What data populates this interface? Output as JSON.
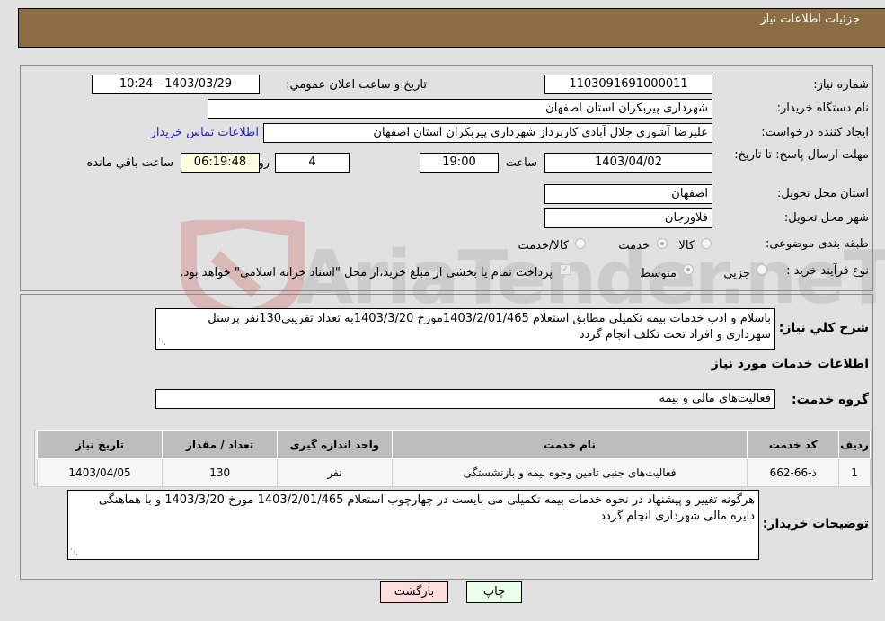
{
  "header": {
    "title": "جزئیات اطلاعات نیاز"
  },
  "fields": {
    "need_number": {
      "label": "شماره نیاز:",
      "value": "1103091691000011"
    },
    "announce_datetime": {
      "label": "تاریخ و ساعت اعلان عمومي:",
      "value": "1403/03/29 - 10:24"
    },
    "buyer_org": {
      "label": "نام دستگاه خریدار:",
      "value": "شهرداری پیربکران استان اصفهان"
    },
    "requester": {
      "label": "ایجاد کننده درخواست:",
      "value": "علیرضا آشوری جلال آبادی کاربرداز شهرداری پیربکران استان اصفهان"
    },
    "buyer_contact_link": "اطلاعات تماس خریدار",
    "deadline": {
      "label": "مهلت ارسال پاسخ: تا تاریخ:",
      "date": "1403/04/02",
      "time_label": "ساعت",
      "time": "19:00",
      "days": "4",
      "days_label": "روز و",
      "remaining": "06:19:48",
      "remaining_label": "ساعت باقي مانده"
    },
    "delivery_province": {
      "label": "استان محل تحویل:",
      "value": "اصفهان"
    },
    "delivery_city": {
      "label": "شهر محل تحویل:",
      "value": "فلاورجان"
    },
    "category": {
      "label": "طبقه بندی موضوعی:",
      "options": [
        "کالا",
        "خدمت",
        "کالا/خدمت"
      ],
      "selected": "خدمت"
    },
    "purchase_process": {
      "label": "نوع فرآیند خرید :",
      "options": [
        "جزیي",
        "متوسط"
      ],
      "selected": "متوسط",
      "treasury_note": "پرداخت تمام یا بخشی از مبلغ خرید،از محل \"اسناد خزانه اسلامی\" خواهد بود."
    }
  },
  "description": {
    "label": "شرح کلي نیاز:",
    "text": "باسلام و ادب خدمات بیمه تکمیلی مطابق استعلام 1403/2/01/465مورخ 1403/3/20به تعداد تقریبی130نفر پرسنل شهرداری و افراد تحت تکلف انجام گردد"
  },
  "services_section": {
    "title": "اطلاعات خدمات مورد نیاز",
    "group_label": "گروه خدمت:",
    "group_value": "فعالیت‌های مالی و بیمه"
  },
  "table": {
    "headers": [
      "ردیف",
      "کد خدمت",
      "نام خدمت",
      "واحد اندازه گیری",
      "تعداد / مقدار",
      "تاریخ نیاز"
    ],
    "rows": [
      [
        "1",
        "ذ-66-662",
        "فعالیت‌های جنبی تامین وجوه بیمه و بازنشستگی",
        "نفر",
        "130",
        "1403/04/05"
      ]
    ]
  },
  "buyer_notes": {
    "label": "توضیحات خریدار:",
    "text": "هرگونه تغییر و پیشنهاد در نحوه خدمات بیمه تکمیلی می بایست در چهارچوب استعلام 1403/2/01/465 مورخ 1403/3/20 و با هماهنگی دایره مالی شهرداری انجام گردد"
  },
  "buttons": {
    "print": "چاپ",
    "back": "بازگشت"
  },
  "watermark": "AriaTender.neT"
}
